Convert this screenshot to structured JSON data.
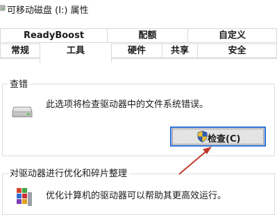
{
  "window": {
    "title": "可移动磁盘 (I:) 属性"
  },
  "tabs": {
    "row1": [
      {
        "label": "ReadyBoost"
      },
      {
        "label": "配额"
      },
      {
        "label": "自定义"
      }
    ],
    "row2": [
      {
        "label": "常规"
      },
      {
        "label": "工具",
        "active": true
      },
      {
        "label": "硬件"
      },
      {
        "label": "共享"
      },
      {
        "label": "安全"
      }
    ]
  },
  "error_checking": {
    "title": "查错",
    "description": "此选项将检查驱动器中的文件系统错误。",
    "button_label": "检查(C)",
    "icon": "drive-icon"
  },
  "optimize": {
    "title": "对驱动器进行优化和碎片整理",
    "description": "优化计算机的驱动器可以帮助其更高效运行。",
    "icon": "defrag-icon"
  },
  "annotation": {
    "arrow_color": "#c0392b"
  },
  "colors": {
    "button_focus_border": "#2d6fd6",
    "shield_blue": "#2f5fb0",
    "shield_yellow": "#f2c230"
  }
}
